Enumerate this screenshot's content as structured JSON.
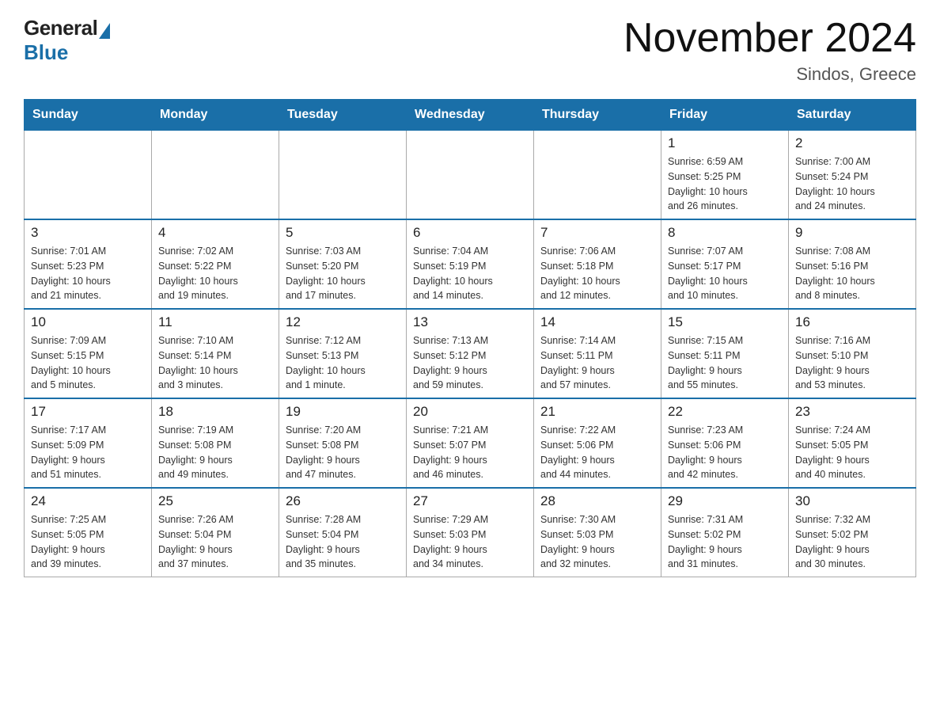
{
  "header": {
    "logo_general": "General",
    "logo_blue": "Blue",
    "title": "November 2024",
    "subtitle": "Sindos, Greece"
  },
  "days_of_week": [
    "Sunday",
    "Monday",
    "Tuesday",
    "Wednesday",
    "Thursday",
    "Friday",
    "Saturday"
  ],
  "weeks": [
    [
      {
        "day": "",
        "info": ""
      },
      {
        "day": "",
        "info": ""
      },
      {
        "day": "",
        "info": ""
      },
      {
        "day": "",
        "info": ""
      },
      {
        "day": "",
        "info": ""
      },
      {
        "day": "1",
        "info": "Sunrise: 6:59 AM\nSunset: 5:25 PM\nDaylight: 10 hours\nand 26 minutes."
      },
      {
        "day": "2",
        "info": "Sunrise: 7:00 AM\nSunset: 5:24 PM\nDaylight: 10 hours\nand 24 minutes."
      }
    ],
    [
      {
        "day": "3",
        "info": "Sunrise: 7:01 AM\nSunset: 5:23 PM\nDaylight: 10 hours\nand 21 minutes."
      },
      {
        "day": "4",
        "info": "Sunrise: 7:02 AM\nSunset: 5:22 PM\nDaylight: 10 hours\nand 19 minutes."
      },
      {
        "day": "5",
        "info": "Sunrise: 7:03 AM\nSunset: 5:20 PM\nDaylight: 10 hours\nand 17 minutes."
      },
      {
        "day": "6",
        "info": "Sunrise: 7:04 AM\nSunset: 5:19 PM\nDaylight: 10 hours\nand 14 minutes."
      },
      {
        "day": "7",
        "info": "Sunrise: 7:06 AM\nSunset: 5:18 PM\nDaylight: 10 hours\nand 12 minutes."
      },
      {
        "day": "8",
        "info": "Sunrise: 7:07 AM\nSunset: 5:17 PM\nDaylight: 10 hours\nand 10 minutes."
      },
      {
        "day": "9",
        "info": "Sunrise: 7:08 AM\nSunset: 5:16 PM\nDaylight: 10 hours\nand 8 minutes."
      }
    ],
    [
      {
        "day": "10",
        "info": "Sunrise: 7:09 AM\nSunset: 5:15 PM\nDaylight: 10 hours\nand 5 minutes."
      },
      {
        "day": "11",
        "info": "Sunrise: 7:10 AM\nSunset: 5:14 PM\nDaylight: 10 hours\nand 3 minutes."
      },
      {
        "day": "12",
        "info": "Sunrise: 7:12 AM\nSunset: 5:13 PM\nDaylight: 10 hours\nand 1 minute."
      },
      {
        "day": "13",
        "info": "Sunrise: 7:13 AM\nSunset: 5:12 PM\nDaylight: 9 hours\nand 59 minutes."
      },
      {
        "day": "14",
        "info": "Sunrise: 7:14 AM\nSunset: 5:11 PM\nDaylight: 9 hours\nand 57 minutes."
      },
      {
        "day": "15",
        "info": "Sunrise: 7:15 AM\nSunset: 5:11 PM\nDaylight: 9 hours\nand 55 minutes."
      },
      {
        "day": "16",
        "info": "Sunrise: 7:16 AM\nSunset: 5:10 PM\nDaylight: 9 hours\nand 53 minutes."
      }
    ],
    [
      {
        "day": "17",
        "info": "Sunrise: 7:17 AM\nSunset: 5:09 PM\nDaylight: 9 hours\nand 51 minutes."
      },
      {
        "day": "18",
        "info": "Sunrise: 7:19 AM\nSunset: 5:08 PM\nDaylight: 9 hours\nand 49 minutes."
      },
      {
        "day": "19",
        "info": "Sunrise: 7:20 AM\nSunset: 5:08 PM\nDaylight: 9 hours\nand 47 minutes."
      },
      {
        "day": "20",
        "info": "Sunrise: 7:21 AM\nSunset: 5:07 PM\nDaylight: 9 hours\nand 46 minutes."
      },
      {
        "day": "21",
        "info": "Sunrise: 7:22 AM\nSunset: 5:06 PM\nDaylight: 9 hours\nand 44 minutes."
      },
      {
        "day": "22",
        "info": "Sunrise: 7:23 AM\nSunset: 5:06 PM\nDaylight: 9 hours\nand 42 minutes."
      },
      {
        "day": "23",
        "info": "Sunrise: 7:24 AM\nSunset: 5:05 PM\nDaylight: 9 hours\nand 40 minutes."
      }
    ],
    [
      {
        "day": "24",
        "info": "Sunrise: 7:25 AM\nSunset: 5:05 PM\nDaylight: 9 hours\nand 39 minutes."
      },
      {
        "day": "25",
        "info": "Sunrise: 7:26 AM\nSunset: 5:04 PM\nDaylight: 9 hours\nand 37 minutes."
      },
      {
        "day": "26",
        "info": "Sunrise: 7:28 AM\nSunset: 5:04 PM\nDaylight: 9 hours\nand 35 minutes."
      },
      {
        "day": "27",
        "info": "Sunrise: 7:29 AM\nSunset: 5:03 PM\nDaylight: 9 hours\nand 34 minutes."
      },
      {
        "day": "28",
        "info": "Sunrise: 7:30 AM\nSunset: 5:03 PM\nDaylight: 9 hours\nand 32 minutes."
      },
      {
        "day": "29",
        "info": "Sunrise: 7:31 AM\nSunset: 5:02 PM\nDaylight: 9 hours\nand 31 minutes."
      },
      {
        "day": "30",
        "info": "Sunrise: 7:32 AM\nSunset: 5:02 PM\nDaylight: 9 hours\nand 30 minutes."
      }
    ]
  ]
}
